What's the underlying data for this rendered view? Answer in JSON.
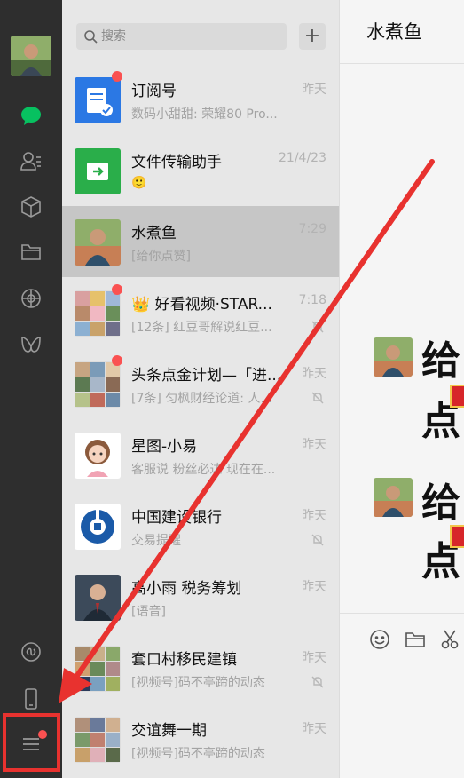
{
  "search": {
    "placeholder": "搜索"
  },
  "add_label": "+",
  "conversations": [
    {
      "name": "订阅号",
      "time": "昨天",
      "preview": "数码小甜甜: 荣耀80 Pro...",
      "badge": true,
      "muted": false,
      "icon": "subscription-icon"
    },
    {
      "name": "文件传输助手",
      "time": "21/4/23",
      "preview": "🙂",
      "badge": false,
      "muted": false,
      "icon": "file-transfer-icon"
    },
    {
      "name": "水煮鱼",
      "time": "7:29",
      "preview": "[给你点赞]",
      "badge": false,
      "muted": false,
      "selected": true
    },
    {
      "name": "👑 好看视频·STAR...",
      "time": "7:18",
      "preview": "[12条] 红豆哥解说红豆...",
      "badge": true,
      "muted": true
    },
    {
      "name": "头条点金计划—「进...",
      "time": "昨天",
      "preview": "[7条] 匀枫财经论道: 人...",
      "badge": true,
      "muted": true
    },
    {
      "name": "星图-小易",
      "time": "昨天",
      "preview": "客服说 粉丝必达 现在在...",
      "badge": false,
      "muted": false
    },
    {
      "name": "中国建设银行",
      "time": "昨天",
      "preview": "交易提醒",
      "badge": false,
      "muted": true
    },
    {
      "name": "高小雨 税务筹划",
      "time": "昨天",
      "preview": "[语音]",
      "badge": false,
      "muted": false
    },
    {
      "name": "套口村移民建镇",
      "time": "昨天",
      "preview": "[视频号]码不亭蹄的动态",
      "badge": false,
      "muted": true
    },
    {
      "name": "交谊舞一期",
      "time": "昨天",
      "preview": "[视频号]码不亭蹄的动态",
      "badge": false,
      "muted": false
    }
  ],
  "chat": {
    "title": "水煮鱼",
    "stickers": [
      {
        "line1": "给",
        "line2": "点"
      },
      {
        "line1": "给",
        "line2": "点"
      }
    ]
  },
  "colors": {
    "accent_green": "#07c160",
    "badge_red": "#fa5151",
    "annotation_red": "#e8322f"
  }
}
